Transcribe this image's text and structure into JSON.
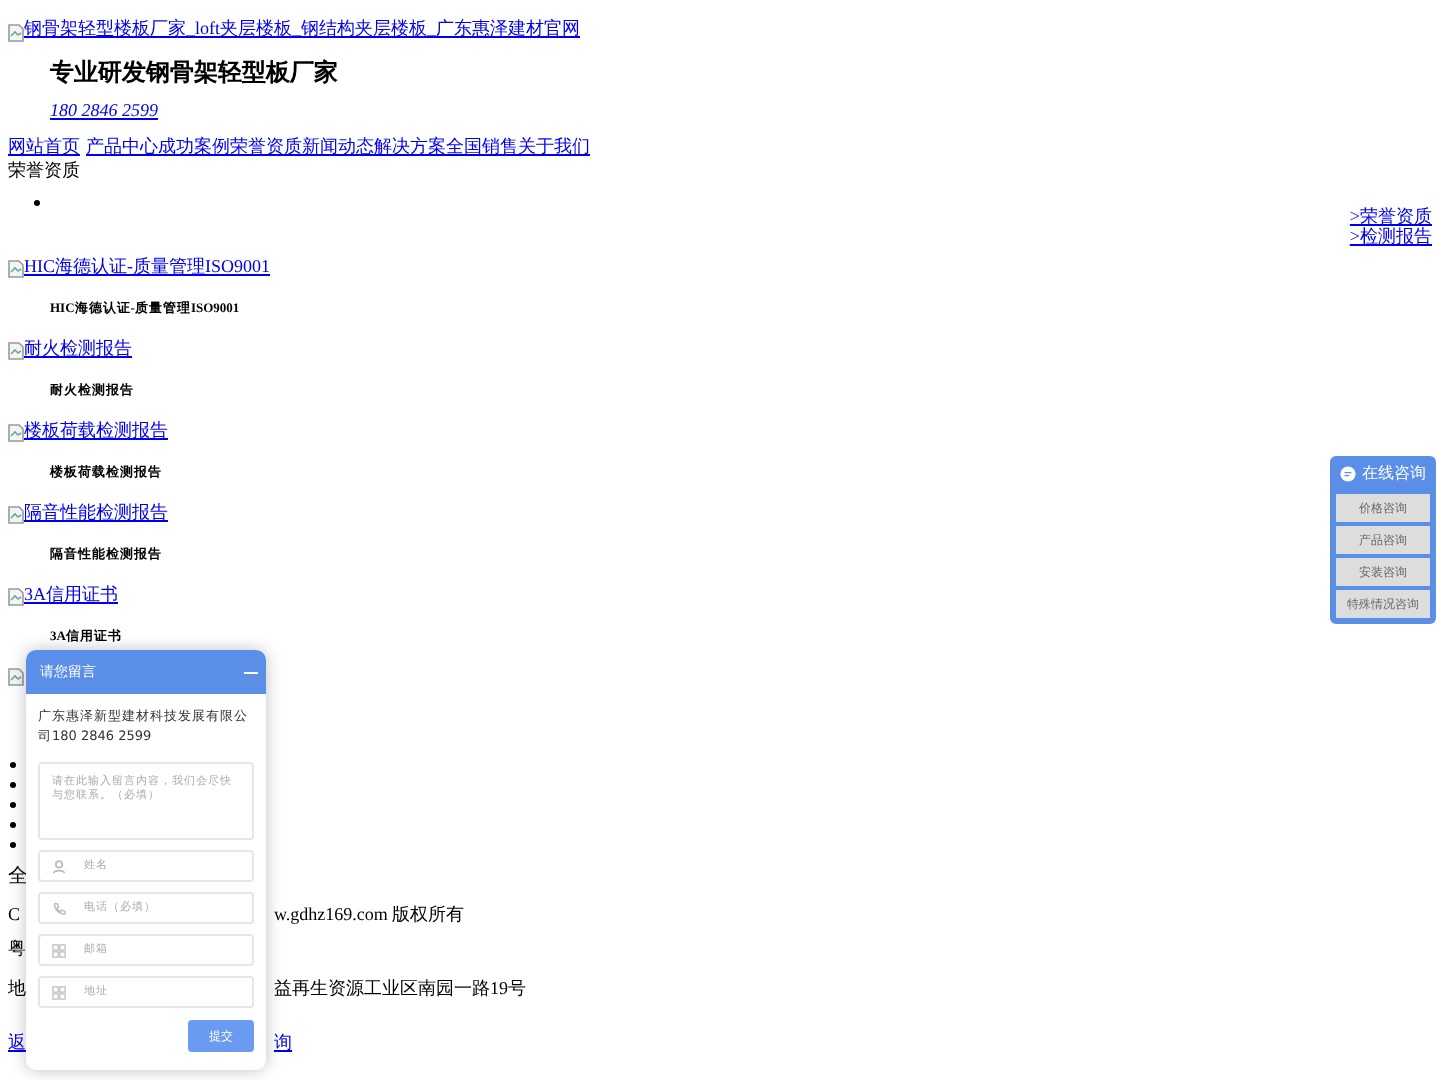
{
  "header": {
    "logo_alt": "钢骨架轻型楼板厂家_loft夹层楼板_钢结构夹层楼板_广东惠泽建材官网",
    "slogan": "专业研发钢骨架轻型板厂家",
    "phone": "180 2846 2599"
  },
  "nav": [
    "网站首页",
    "产品中心",
    "成功案例",
    "荣誉资质",
    "新闻动态",
    "解决方案",
    "全国销售",
    "关于我们"
  ],
  "breadcrumb": "荣誉资质",
  "side_links": [
    ">荣誉资质",
    ">检测报告"
  ],
  "certificates": [
    {
      "image_alt": "HIC海德认证-质量管理ISO9001",
      "caption": "HIC海德认证-质量管理ISO9001"
    },
    {
      "image_alt": "耐火检测报告",
      "caption": "耐火检测报告"
    },
    {
      "image_alt": "楼板荷载检测报告",
      "caption": "楼板荷载检测报告"
    },
    {
      "image_alt": "隔音性能检测报告",
      "caption": "隔音性能检测报告"
    },
    {
      "image_alt": "3A信用证书",
      "caption": "3A信用证书"
    }
  ],
  "footer": {
    "line_1": "全",
    "line_2_left": "C",
    "line_2_right": "w.gdhz169.com 版权所有",
    "line_3": "粤",
    "line_4_left": "地",
    "line_4_right": "益再生资源工业区南园一路19号",
    "link_left": "返",
    "link_right": "询"
  },
  "chat_widget": {
    "title": "在线咨询",
    "buttons": [
      "价格咨询",
      "产品咨询",
      "安装咨询",
      "特殊情况咨询"
    ]
  },
  "message_panel": {
    "title": "请您留言",
    "company": "广东惠泽新型建材科技发展有限公司180 2846 2599",
    "message_placeholder": "请在此输入留言内容，我们会尽快与您联系。（必填）",
    "fields": [
      {
        "kind": "person",
        "placeholder": "姓名"
      },
      {
        "kind": "phone",
        "placeholder": "电话（必填）"
      },
      {
        "kind": "mail",
        "placeholder": "邮箱"
      },
      {
        "kind": "address",
        "placeholder": "地址"
      }
    ],
    "submit": "提交"
  }
}
